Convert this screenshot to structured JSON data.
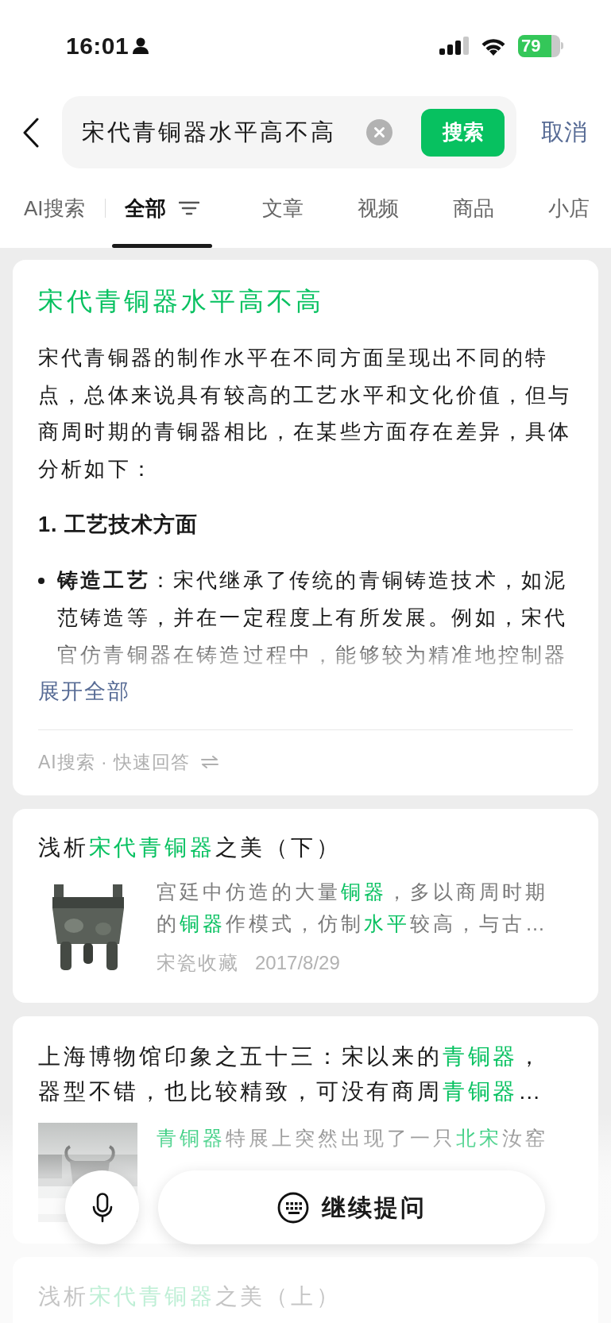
{
  "status_bar": {
    "time": "16:01",
    "battery": "79"
  },
  "search": {
    "value": "宋代青铜器水平高不高",
    "button": "搜索",
    "cancel": "取消"
  },
  "tabs": [
    {
      "label": "AI搜索",
      "selected": false,
      "filter": false
    },
    {
      "label": "全部",
      "selected": true,
      "filter": true
    },
    {
      "label": "文章",
      "selected": false,
      "filter": false
    },
    {
      "label": "视频",
      "selected": false,
      "filter": false
    },
    {
      "label": "商品",
      "selected": false,
      "filter": false
    },
    {
      "label": "小店",
      "selected": false,
      "filter": false
    }
  ],
  "ai_answer": {
    "title": "宋代青铜器水平高不高",
    "paragraph": "宋代青铜器的制作水平在不同方面呈现出不同的特点，总体来说具有较高的工艺水平和文化价值，但与商周时期的青铜器相比，在某些方面存在差异，具体分析如下：",
    "heading": "1. 工艺技术方面",
    "bullet": "**铸造工艺**：宋代继承了传统的青铜铸造技术，如泥范铸造等，并在一定程度上有所发展。例如，宋代官仿青铜器在铸造过程中，能够较为精准地控制器",
    "expand": "展开全部",
    "footer": "AI搜索 · 快速回答"
  },
  "results": [
    {
      "title": [
        {
          "text": "浅析",
          "highlight": false
        },
        {
          "text": "宋代青铜器",
          "highlight": true
        },
        {
          "text": "之美（下）",
          "highlight": false
        }
      ],
      "thumbnail": {
        "kind": "picture"
      },
      "snippet": [
        {
          "text": "宫廷中仿造的大量",
          "highlight": false
        },
        {
          "text": "铜器",
          "highlight": true
        },
        {
          "text": "，多以商周时期的",
          "highlight": false
        },
        {
          "text": "铜器",
          "highlight": true
        },
        {
          "text": "作模式，仿制",
          "highlight": false
        },
        {
          "text": "水平",
          "highlight": true
        },
        {
          "text": "较高，与古…",
          "highlight": false
        }
      ],
      "source": "宋瓷收藏",
      "date": "2017/8/29"
    },
    {
      "title": [
        {
          "text": "上海博物馆印象之五十三：宋以来的",
          "highlight": false
        },
        {
          "text": "青铜器",
          "highlight": true
        },
        {
          "text": "，器型不错，也比较精致，可没有商周",
          "highlight": false
        },
        {
          "text": "青铜器",
          "highlight": true
        },
        {
          "text": "…",
          "highlight": false
        }
      ],
      "thumbnail": {
        "kind": "picture"
      },
      "snippet": [
        {
          "text": "青铜器",
          "highlight": true
        },
        {
          "text": "特展上突然出现了一只",
          "highlight": false
        },
        {
          "text": "北宋",
          "highlight": true
        },
        {
          "text": "汝窑",
          "highlight": false
        }
      ]
    },
    {
      "title": [
        {
          "text": "浅析",
          "highlight": false
        },
        {
          "text": "宋代青铜器",
          "highlight": true
        },
        {
          "text": "之美（上）",
          "highlight": false
        }
      ]
    }
  ],
  "ask_bar": {
    "label": "继续提问"
  }
}
